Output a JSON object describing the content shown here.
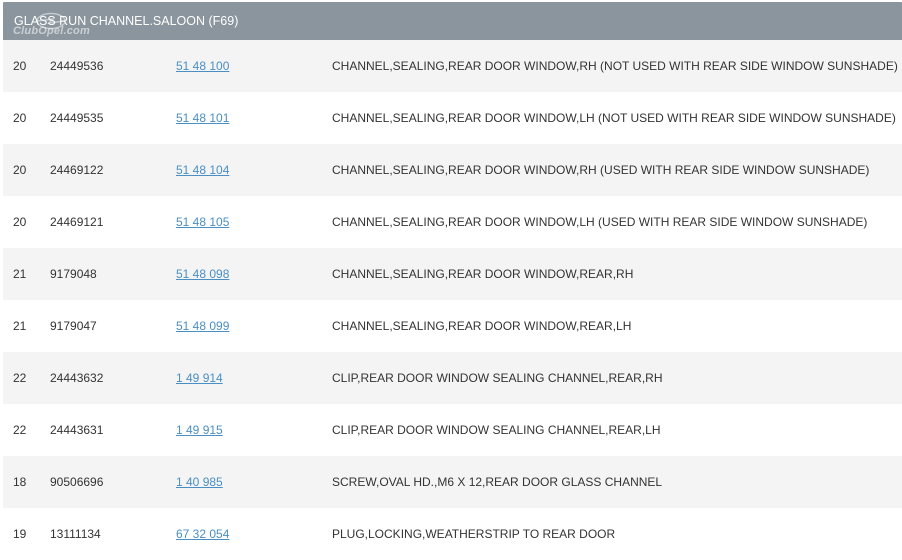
{
  "header": {
    "title": "GLASS RUN CHANNEL.SALOON (F69)",
    "watermark": "ClubOpel.com"
  },
  "rows": [
    {
      "ref": "20",
      "part": "24449536",
      "catalog": "51 48 100",
      "description": "CHANNEL,SEALING,REAR DOOR WINDOW,RH (NOT USED WITH REAR SIDE WINDOW SUNSHADE)"
    },
    {
      "ref": "20",
      "part": "24449535",
      "catalog": "51 48 101",
      "description": "CHANNEL,SEALING,REAR DOOR WINDOW,LH (NOT USED WITH REAR SIDE WINDOW SUNSHADE)"
    },
    {
      "ref": "20",
      "part": "24469122",
      "catalog": "51 48 104",
      "description": "CHANNEL,SEALING,REAR DOOR WINDOW,RH (USED WITH REAR SIDE WINDOW SUNSHADE)"
    },
    {
      "ref": "20",
      "part": "24469121",
      "catalog": "51 48 105",
      "description": "CHANNEL,SEALING,REAR DOOR WINDOW,LH (USED WITH REAR SIDE WINDOW SUNSHADE)"
    },
    {
      "ref": "21",
      "part": "9179048",
      "catalog": "51 48 098",
      "description": "CHANNEL,SEALING,REAR DOOR WINDOW,REAR,RH"
    },
    {
      "ref": "21",
      "part": "9179047",
      "catalog": "51 48 099",
      "description": "CHANNEL,SEALING,REAR DOOR WINDOW,REAR,LH"
    },
    {
      "ref": "22",
      "part": "24443632",
      "catalog": "1 49 914",
      "description": "CLIP,REAR DOOR WINDOW SEALING CHANNEL,REAR,RH"
    },
    {
      "ref": "22",
      "part": "24443631",
      "catalog": "1 49 915",
      "description": "CLIP,REAR DOOR WINDOW SEALING CHANNEL,REAR,LH"
    },
    {
      "ref": "18",
      "part": "90506696",
      "catalog": "1 40 985",
      "description": "SCREW,OVAL HD.,M6 X 12,REAR DOOR GLASS CHANNEL"
    },
    {
      "ref": "19",
      "part": "13111134",
      "catalog": "67 32 054",
      "description": "PLUG,LOCKING,WEATHERSTRIP TO REAR DOOR"
    }
  ],
  "colors": {
    "header_bg": "#8a959e",
    "link": "#4a8fc4",
    "row_alt": "#f4f4f4"
  }
}
